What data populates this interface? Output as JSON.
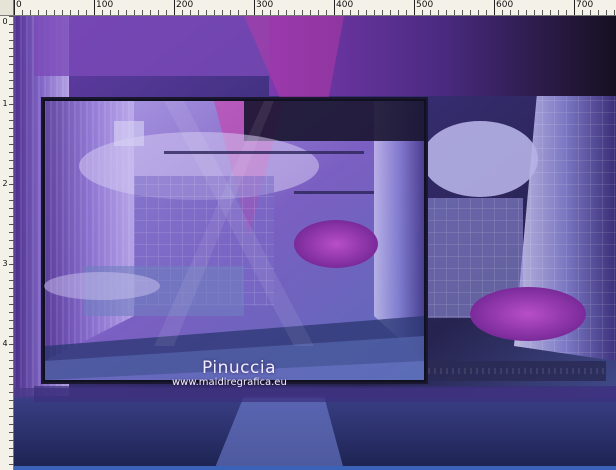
{
  "ruler": {
    "top_labels": [
      "0",
      "100",
      "200",
      "300",
      "400",
      "500",
      "600",
      "700"
    ],
    "left_labels": [
      "0",
      "1",
      "2",
      "3",
      "4"
    ]
  },
  "canvas": {
    "signature_name": "Pinuccia",
    "signature_url": "www.maidiregrafica.eu"
  },
  "colors": {
    "deep_purple": "#2a2350",
    "magenta": "#b02aa0",
    "lavender": "#b9a3e6",
    "steel_blue": "#5f73b8"
  }
}
